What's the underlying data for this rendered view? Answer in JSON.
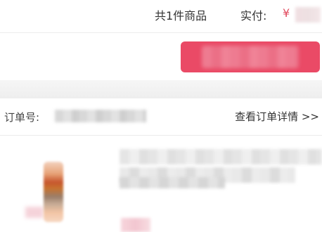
{
  "summary": {
    "item_count_text": "共1件商品",
    "paid_label": "实付:",
    "currency_symbol": "¥"
  },
  "order": {
    "number_label": "订单号:",
    "view_details_link": "查看订单详情 >>"
  },
  "colors": {
    "accent": "#ea4a66",
    "price": "#e14a5e"
  }
}
